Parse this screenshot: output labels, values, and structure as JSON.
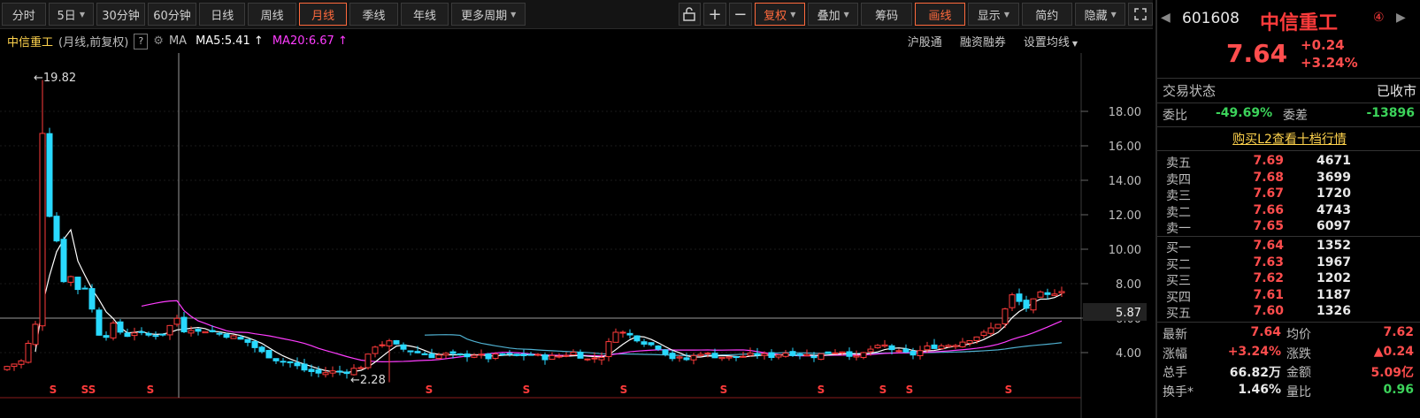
{
  "toolbar": {
    "periods": [
      "分时",
      "5日",
      "30分钟",
      "60分钟",
      "日线",
      "周线",
      "月线",
      "季线",
      "年线",
      "更多周期"
    ],
    "active_period": "月线",
    "tools": [
      "复权",
      "叠加",
      "筹码",
      "画线",
      "显示",
      "简约",
      "隐藏"
    ],
    "active_tools": [
      "复权",
      "画线"
    ]
  },
  "header2": {
    "stock_name": "中信重工",
    "sub": "(月线,前复权)",
    "help": "?",
    "ma_label": "MA",
    "ma5": "MA5:5.41",
    "ma20": "MA20:6.67",
    "links": [
      "沪股通",
      "融资融券",
      "设置均线"
    ]
  },
  "chart_annotations": {
    "high": "19.82",
    "low": "2.28",
    "last_price": "5.87",
    "signal_mark": "S"
  },
  "chart_data": {
    "type": "candlestick",
    "yticks": [
      4.0,
      6.0,
      8.0,
      10.0,
      12.0,
      14.0,
      16.0,
      18.0
    ],
    "ylim": [
      2.0,
      20.0
    ],
    "high_label": 19.82,
    "low_label": 2.28,
    "ma5_last": 5.41,
    "ma20_last": 6.67,
    "colors": {
      "up": "#ff3b3b",
      "down": "#29d9ff",
      "ma5": "#ffffff",
      "ma20": "#ff3cff",
      "ma60": "#4fb0d0"
    }
  },
  "panel": {
    "code": "601608",
    "name": "中信重工",
    "badge": "④",
    "price": "7.64",
    "change": "+0.24",
    "change_pct": "+3.24%",
    "trade_status_label": "交易状态",
    "trade_status": "已收市",
    "wb_label": "委比",
    "wb_value": "-49.69%",
    "wc_label": "委差",
    "wc_value": "-13896",
    "l2_link": "购买L2查看十档行情",
    "asks": [
      {
        "label": "卖五",
        "price": "7.69",
        "vol": "4671"
      },
      {
        "label": "卖四",
        "price": "7.68",
        "vol": "3699"
      },
      {
        "label": "卖三",
        "price": "7.67",
        "vol": "1720"
      },
      {
        "label": "卖二",
        "price": "7.66",
        "vol": "4743"
      },
      {
        "label": "卖一",
        "price": "7.65",
        "vol": "6097"
      }
    ],
    "bids": [
      {
        "label": "买一",
        "price": "7.64",
        "vol": "1352"
      },
      {
        "label": "买二",
        "price": "7.63",
        "vol": "1967"
      },
      {
        "label": "买三",
        "price": "7.62",
        "vol": "1202"
      },
      {
        "label": "买四",
        "price": "7.61",
        "vol": "1187"
      },
      {
        "label": "买五",
        "price": "7.60",
        "vol": "1326"
      }
    ],
    "stats": [
      {
        "l1": "最新",
        "v1": "7.64",
        "l2": "均价",
        "v2": "7.62"
      },
      {
        "l1": "涨幅",
        "v1": "+3.24%",
        "l2": "涨跌",
        "v2": "▲0.24"
      },
      {
        "l1": "总手",
        "v1": "66.82万",
        "l2": "金额",
        "v2": "5.09亿"
      },
      {
        "l1": "换手*",
        "v1": "1.46%",
        "l2": "量比",
        "v2": "0.96"
      }
    ]
  }
}
